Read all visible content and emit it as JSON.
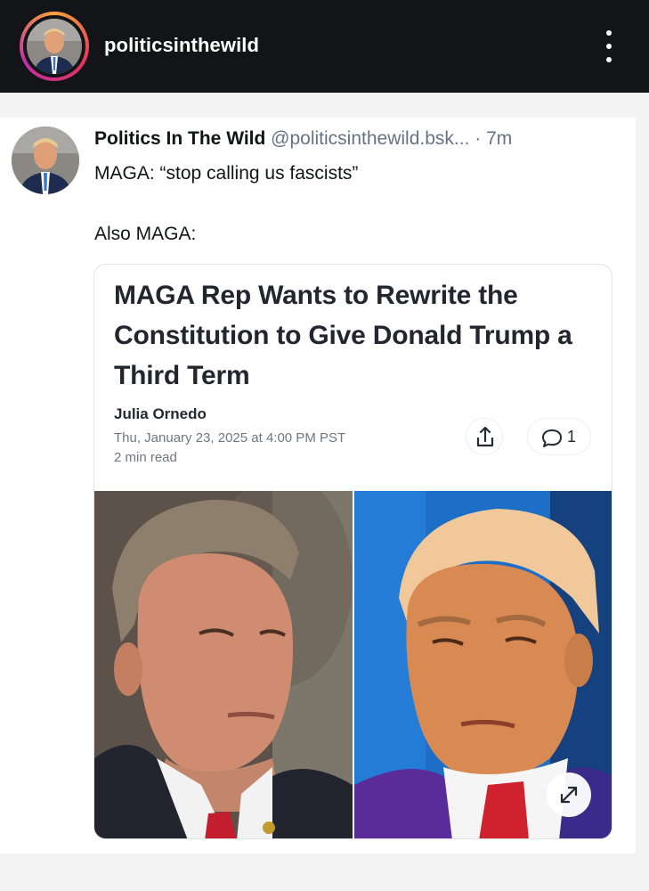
{
  "story": {
    "username": "politicsinthewild"
  },
  "post": {
    "display_name": "Politics In The Wild",
    "handle": "@politicsinthewild.bsk...",
    "time": "· 7m",
    "text_line1": "MAGA: “stop calling us fascists”",
    "text_line2": "Also MAGA:",
    "embed": {
      "title": "MAGA Rep Wants to Rewrite the Constitution to Give Donald Trump a Third Term",
      "author": "Julia Ornedo",
      "date": "Thu, January 23, 2025 at 4:00 PM PST",
      "read_time": "2 min read",
      "comment_count": "1"
    }
  },
  "colors": {
    "topbar_bg": "#121418",
    "text_primary": "#121418",
    "text_muted": "#667383",
    "card_border": "#e1e4e8",
    "page_bg": "#f3f3f4"
  },
  "icons": [
    "more-vertical-icon",
    "share-icon",
    "comment-bubble-icon",
    "expand-icon"
  ]
}
